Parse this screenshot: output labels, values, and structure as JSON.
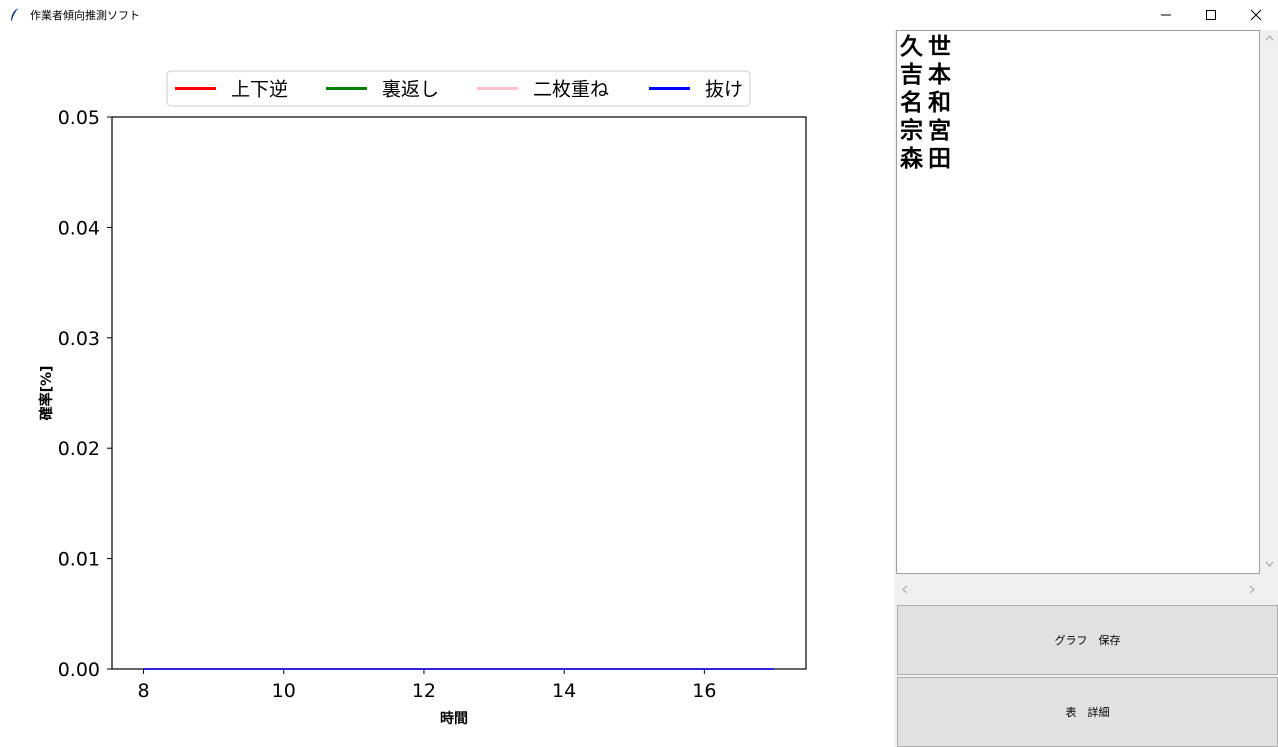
{
  "window": {
    "title": "作業者傾向推測ソフト",
    "icons": [
      "feather-icon",
      "minimize-icon",
      "maximize-icon",
      "close-icon"
    ]
  },
  "names": [
    "久世",
    "吉本",
    "名和",
    "宗宮",
    "森田"
  ],
  "buttons": {
    "graph_save": "グラフ　保存",
    "table_detail": "表　詳細"
  },
  "chart_data": {
    "type": "line",
    "title": "",
    "xlabel": "時間",
    "ylabel": "確率[%]",
    "xlim": [
      7.55,
      17.45
    ],
    "ylim": [
      0,
      0.05
    ],
    "xticks": [
      "8",
      "10",
      "12",
      "14",
      "16"
    ],
    "yticks": [
      "0.00",
      "0.01",
      "0.02",
      "0.03",
      "0.04",
      "0.05"
    ],
    "legend_position": "top-center",
    "grid": false,
    "x": [
      8,
      9,
      10,
      11,
      12,
      13,
      14,
      15,
      16,
      17
    ],
    "series": [
      {
        "name": "上下逆",
        "color": "#ff0000",
        "values": [
          0,
          0,
          0,
          0,
          0,
          0,
          0,
          0,
          0,
          0
        ]
      },
      {
        "name": "裏返し",
        "color": "#008000",
        "values": [
          0,
          0,
          0,
          0,
          0,
          0,
          0,
          0,
          0,
          0
        ]
      },
      {
        "name": "二枚重ね",
        "color": "#ffc0cb",
        "values": [
          0,
          0,
          0,
          0,
          0,
          0,
          0,
          0,
          0,
          0
        ]
      },
      {
        "name": "抜け",
        "color": "#0000ff",
        "values": [
          0,
          0,
          0,
          0,
          0,
          0,
          0,
          0,
          0,
          0
        ]
      }
    ]
  }
}
